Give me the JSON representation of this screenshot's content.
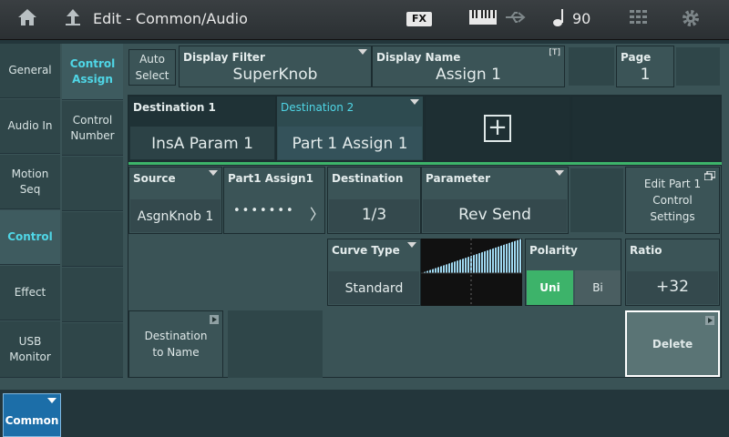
{
  "header": {
    "title": "Edit - Common/Audio",
    "fx_label": "FX",
    "tempo": "90",
    "icons": [
      "home-icon",
      "back-arrow-icon",
      "keyboard-icon",
      "usb-icon",
      "note-icon",
      "grid-icon",
      "gear-icon"
    ]
  },
  "left_tabs": [
    {
      "label": "General"
    },
    {
      "label": "Audio In"
    },
    {
      "label": "Motion Seq"
    },
    {
      "label": "Control"
    },
    {
      "label": "Effect"
    },
    {
      "label": "USB Monitor"
    }
  ],
  "sub_tabs": [
    {
      "label": "Control Assign"
    },
    {
      "label": "Control Number"
    }
  ],
  "auto_select": "Auto Select",
  "display_filter": {
    "label": "Display Filter",
    "value": "SuperKnob"
  },
  "display_name": {
    "label": "Display Name",
    "value": "Assign 1",
    "tag": "[T]"
  },
  "page": {
    "label": "Page",
    "value": "1"
  },
  "destinations": [
    {
      "label": "Destination 1",
      "value": "InsA Param 1"
    },
    {
      "label": "Destination 2",
      "value": "Part 1 Assign 1"
    }
  ],
  "add_symbol": "+",
  "source": {
    "label": "Source",
    "value": "AsgnKnob 1"
  },
  "part_assign": {
    "label": "Part1 Assign1",
    "dots": "•••••••",
    "chevron": "〉"
  },
  "destination": {
    "label": "Destination",
    "value": "1/3"
  },
  "parameter": {
    "label": "Parameter",
    "value": "Rev Send"
  },
  "edit_part_button": "Edit Part 1 Control Settings",
  "curve_type": {
    "label": "Curve Type",
    "value": "Standard"
  },
  "polarity": {
    "label": "Polarity",
    "options": [
      "Uni",
      "Bi"
    ],
    "selected": "Uni"
  },
  "ratio": {
    "label": "Ratio",
    "value": "+32"
  },
  "destination_to_name": "Destination to Name",
  "delete_button": "Delete",
  "bottom_tab": "Common",
  "colors": {
    "accent_cyan": "#4fd6e6",
    "accent_green": "#3db36a",
    "curve_blue": "#9fd8f0"
  }
}
